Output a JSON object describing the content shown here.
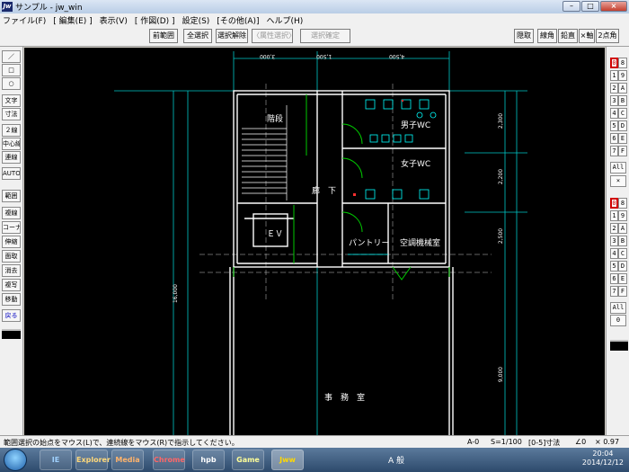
{
  "window": {
    "title": "サンプル - jw_win",
    "icon_label": "Jw",
    "buttons": [
      "–",
      "□",
      "×"
    ]
  },
  "menu": [
    "ファイル(F)",
    "[ 編集(E) ]",
    "表示(V)",
    "[ 作図(D) ]",
    "設定(S)",
    "[その他(A)]",
    "ヘルプ(H)"
  ],
  "toolbar": {
    "buttons": [
      "前範囲",
      "全選択",
      "選択解除",
      "〈属性選択〉",
      "選択確定"
    ],
    "right_buttons": [
      "線角",
      "鉛直",
      "×軸",
      "2点角"
    ],
    "misc_button": "隠取"
  },
  "left_palette": [
    "／",
    "□",
    "○",
    "文字",
    "寸法",
    "２線",
    "中心線",
    "連線",
    "AUTO",
    "範囲",
    "複線",
    "コーナー",
    "伸縮",
    "面取",
    "消去",
    "複写",
    "移動",
    "戻る"
  ],
  "right_palette": {
    "group1": [
      "0",
      "1",
      "2",
      "3",
      "4",
      "5",
      "6",
      "7"
    ],
    "group1_b": [
      "8",
      "9",
      "A",
      "B",
      "C",
      "D",
      "E",
      "F"
    ],
    "all_label": "All",
    "x_label": "×",
    "group2": [
      "0",
      "1",
      "2",
      "3",
      "4",
      "5",
      "6",
      "7"
    ],
    "group2_b": [
      "8",
      "9",
      "A",
      "B",
      "C",
      "D",
      "E",
      "F"
    ],
    "all2_label": "All",
    "zero_label": "0"
  },
  "drawing": {
    "rooms": [
      "階段",
      "男子WC",
      "女子WC",
      "廊　下",
      "ＥＶ",
      "パントリー",
      "空調機械室",
      "事　務　室"
    ],
    "top_dims": [
      "3,000",
      "1,500",
      "4,500"
    ],
    "right_dims": [
      "2,300",
      "2,200",
      "2,500",
      "9,000"
    ],
    "left_dim": "16,000",
    "colors": {
      "wall": "#ffffff",
      "grid": "#00c8c8",
      "dim": "#00c8c8",
      "door": "#00c800",
      "fixture": "#00ffff",
      "red": "#ff3030"
    }
  },
  "status": {
    "message": "範囲選択の始点をマウス(L)で、連続線をマウス(R)で指示してください。",
    "layer": "A-0",
    "scale": "S=1/100",
    "layer_group": "[0-5]寸法",
    "angle": "∠0",
    "zoom": "× 0.97"
  },
  "taskbar": {
    "apps": [
      "IE",
      "Explorer",
      "Media",
      "Chrome",
      "hpb",
      "Game",
      "Jww"
    ],
    "ime": "A 般",
    "clock_time": "20:04",
    "clock_date": "2014/12/12"
  }
}
